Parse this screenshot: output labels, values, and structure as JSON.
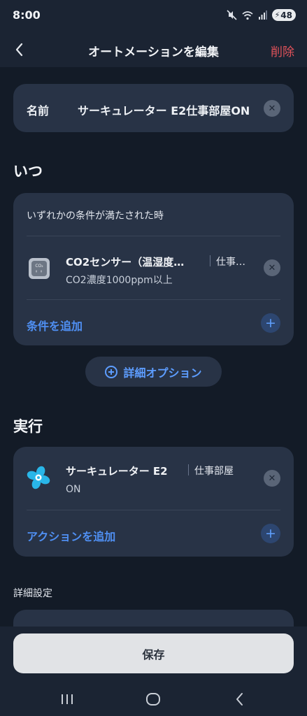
{
  "status_bar": {
    "time": "8:00",
    "battery": "48"
  },
  "header": {
    "title": "オートメーションを編集",
    "delete_label": "削除"
  },
  "name_card": {
    "label": "名前",
    "value": "サーキュレーター E2仕事部屋ON"
  },
  "when_section": {
    "heading": "いつ",
    "condition_mode": "いずれかの条件が満たされた時",
    "conditions": [
      {
        "title": "CO2センサー（温湿度…",
        "room": "仕事…",
        "detail": "CO2濃度1000ppm以上",
        "icon": "co2-sensor-icon"
      }
    ],
    "add_label": "条件を追加"
  },
  "advanced_options_label": "詳細オプション",
  "do_section": {
    "heading": "実行",
    "actions": [
      {
        "title": "サーキュレーター E2",
        "room": "仕事部屋",
        "detail": "ON",
        "icon": "circulator-fan-icon"
      }
    ],
    "add_label": "アクションを追加"
  },
  "detail_settings": {
    "heading": "詳細設定"
  },
  "save_label": "保存",
  "colors": {
    "accent": "#4f8ff2",
    "danger": "#e0525a",
    "background": "#131b27",
    "card": "#283346",
    "save_button": "#e1e3e6"
  }
}
